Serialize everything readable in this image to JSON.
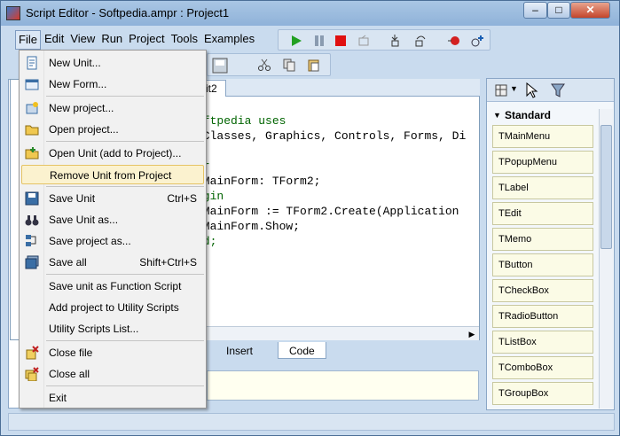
{
  "window": {
    "title": "Script Editor - Softpedia.ampr : Project1"
  },
  "menubar": [
    "File",
    "Edit",
    "View",
    "Run",
    "Project",
    "Tools",
    "Examples"
  ],
  "file_menu": {
    "items": [
      {
        "label": "New Unit...",
        "shortcut": ""
      },
      {
        "label": "New Form...",
        "shortcut": ""
      },
      {
        "label": "New project...",
        "shortcut": ""
      },
      {
        "label": "Open project...",
        "shortcut": ""
      },
      {
        "label": "Open Unit (add to Project)...",
        "shortcut": ""
      },
      {
        "label": "Remove Unit  from Project",
        "shortcut": ""
      },
      {
        "label": "Save Unit",
        "shortcut": "Ctrl+S"
      },
      {
        "label": "Save Unit as...",
        "shortcut": ""
      },
      {
        "label": "Save project as...",
        "shortcut": ""
      },
      {
        "label": "Save all",
        "shortcut": "Shift+Ctrl+S"
      },
      {
        "label": "Save unit as Function Script",
        "shortcut": ""
      },
      {
        "label": "Add project to Utility Scripts",
        "shortcut": ""
      },
      {
        "label": "Utility Scripts List...",
        "shortcut": ""
      },
      {
        "label": "Close file",
        "shortcut": ""
      },
      {
        "label": "Close all",
        "shortcut": ""
      },
      {
        "label": "Exit",
        "shortcut": ""
      }
    ],
    "highlighted": "Remove Unit  from Project"
  },
  "editor": {
    "tab_label": "it2",
    "code_lines": [
      "oftpedia uses",
      " Classes, Graphics, Controls, Forms, Di",
      "",
      "ar",
      " MainForm: TForm2;",
      "egin",
      " MainForm := TForm2.Create(Application",
      " MainForm.Show;",
      "nd;"
    ],
    "bottom_tabs": [
      "Insert",
      "Code"
    ]
  },
  "palette": {
    "header": "Standard",
    "items": [
      "TMainMenu",
      "TPopupMenu",
      "TLabel",
      "TEdit",
      "TMemo",
      "TButton",
      "TCheckBox",
      "TRadioButton",
      "TListBox",
      "TComboBox",
      "TGroupBox"
    ]
  },
  "colors": {
    "accent": "#c9dbee",
    "highlight": "#fbf2cf",
    "keyword": "#006400"
  }
}
